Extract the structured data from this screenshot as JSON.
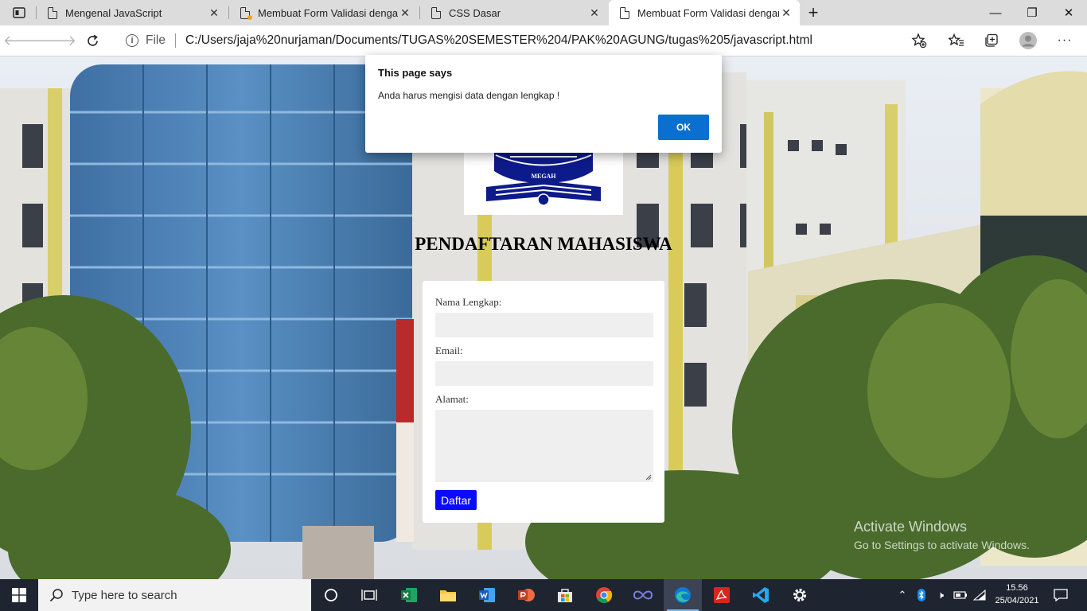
{
  "browser": {
    "tabs": [
      {
        "title": "Mengenal JavaScript",
        "active": false
      },
      {
        "title": "Membuat Form Validasi dengan",
        "active": false
      },
      {
        "title": "CSS Dasar",
        "active": false
      },
      {
        "title": "Membuat Form Validasi dengan",
        "active": true
      }
    ],
    "new_tab_label": "+",
    "window_controls": {
      "minimize": "—",
      "maximize": "❐",
      "close": "✕"
    },
    "address": {
      "scheme_label": "File",
      "url": "C:/Users/jaja%20nurjaman/Documents/TUGAS%20SEMESTER%204/PAK%20AGUNG/tugas%205/javascript.html"
    }
  },
  "page": {
    "logo_text": "MEGAH",
    "title": "PENDAFTARAN MAHASISWA",
    "form": {
      "name_label": "Nama Lengkap:",
      "email_label": "Email:",
      "address_label": "Alamat:",
      "name_value": "",
      "email_value": "",
      "address_value": "",
      "submit_label": "Daftar"
    }
  },
  "alert": {
    "title": "This page says",
    "message": "Anda harus mengisi data dengan lengkap !",
    "ok_label": "OK"
  },
  "watermark": {
    "title": "Activate Windows",
    "subtitle": "Go to Settings to activate Windows."
  },
  "taskbar": {
    "search_placeholder": "Type here to search",
    "time": "15.56",
    "date": "25/04/2021",
    "apps": [
      "task-view",
      "excel",
      "file-explorer",
      "word",
      "powerpoint",
      "store",
      "chrome",
      "loop",
      "edge",
      "acrobat",
      "vscode",
      "settings"
    ]
  },
  "colors": {
    "accent_blue": "#0b6fd1",
    "submit_blue": "#0a0aff",
    "taskbar": "#1e2430"
  }
}
